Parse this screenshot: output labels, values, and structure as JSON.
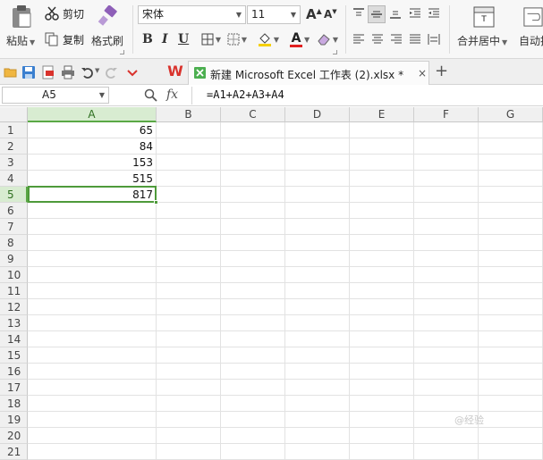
{
  "ribbon": {
    "paste_label": "粘贴",
    "cut_label": "剪切",
    "copy_label": "复制",
    "format_painter_label": "格式刷",
    "font_name": "宋体",
    "font_size": "11",
    "bold_label": "B",
    "italic_label": "I",
    "underline_label": "U",
    "increase_font_label": "A",
    "decrease_font_label": "A",
    "font_color_label": "A",
    "merge_center_label": "合并居中",
    "auto_wrap_label": "自动换"
  },
  "tabbar": {
    "app_label": "W",
    "doc_title": "新建 Microsoft Excel 工作表 (2).xlsx *",
    "close_label": "×",
    "new_tab_label": "+"
  },
  "formula_bar": {
    "name_box": "A5",
    "fx_label": "fx",
    "formula": "=A1+A2+A3+A4"
  },
  "sheet": {
    "columns": [
      "A",
      "B",
      "C",
      "D",
      "E",
      "F",
      "G"
    ],
    "rows": [
      "1",
      "2",
      "3",
      "4",
      "5",
      "6",
      "7",
      "8",
      "9",
      "10",
      "11",
      "12",
      "13",
      "14",
      "15",
      "16",
      "17",
      "18",
      "19",
      "20",
      "21"
    ],
    "values_col_a": [
      "65",
      "84",
      "153",
      "515",
      "817"
    ],
    "active_cell": "A5"
  },
  "watermark": "@经验",
  "colors": {
    "accent_green": "#4e9a3a",
    "header_active_bg": "#d8ecd1",
    "wps_red": "#d9322c"
  }
}
